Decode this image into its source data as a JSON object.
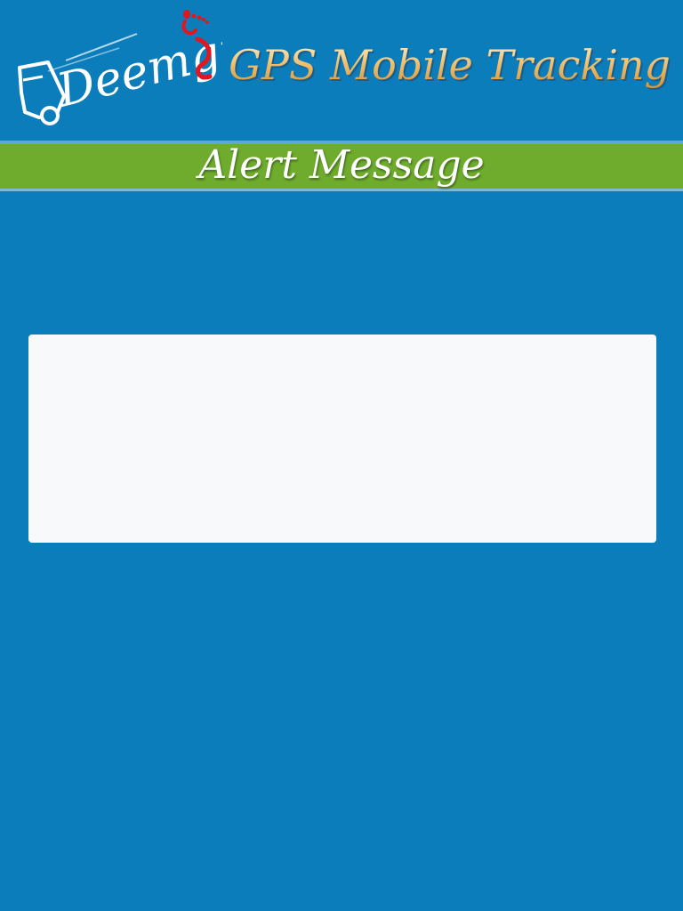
{
  "header": {
    "logo": {
      "brand_text": "Deemgps",
      "icon": "delivery-truck-footprint-logo",
      "brand_color": "#ffffff",
      "accent_color": "#e2161e"
    },
    "app_title": "GPS Mobile Tracking",
    "title_color": "#f1c272"
  },
  "banner": {
    "title": "Alert Message",
    "color": "#6fac2d"
  },
  "alert": {
    "message": ""
  },
  "colors": {
    "background": "#0b7dbb",
    "panel": "#f8f9fa"
  }
}
